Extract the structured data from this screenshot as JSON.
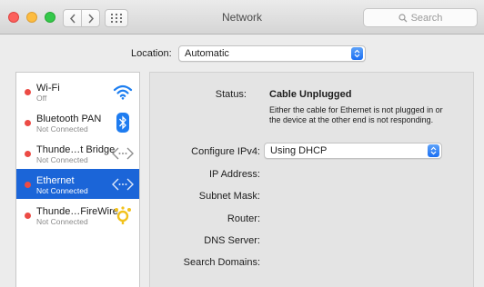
{
  "window": {
    "title": "Network"
  },
  "search": {
    "placeholder": "Search"
  },
  "location": {
    "label": "Location:",
    "value": "Automatic"
  },
  "services": [
    {
      "name": "Wi-Fi",
      "status": "Off",
      "icon": "wifi-icon",
      "selected": false
    },
    {
      "name": "Bluetooth PAN",
      "status": "Not Connected",
      "icon": "bluetooth-icon",
      "selected": false
    },
    {
      "name": "Thunde…t Bridge",
      "status": "Not Connected",
      "icon": "ethernet-arrows-icon",
      "selected": false
    },
    {
      "name": "Ethernet",
      "status": "Not Connected",
      "icon": "ethernet-arrows-icon",
      "selected": true
    },
    {
      "name": "Thunde…FireWire",
      "status": "Not Connected",
      "icon": "firewire-icon",
      "selected": false
    }
  ],
  "detail": {
    "status_label": "Status:",
    "status_value": "Cable Unplugged",
    "status_description": "Either the cable for Ethernet is not plugged in or the device at the other end is not responding.",
    "configure_label": "Configure IPv4:",
    "configure_value": "Using DHCP",
    "ip_label": "IP Address:",
    "subnet_label": "Subnet Mask:",
    "router_label": "Router:",
    "dns_label": "DNS Server:",
    "search_domains_label": "Search Domains:"
  },
  "colors": {
    "selection": "#1b65d8",
    "status_dot": "#ec4b45",
    "accent": "#1b6ff3"
  }
}
